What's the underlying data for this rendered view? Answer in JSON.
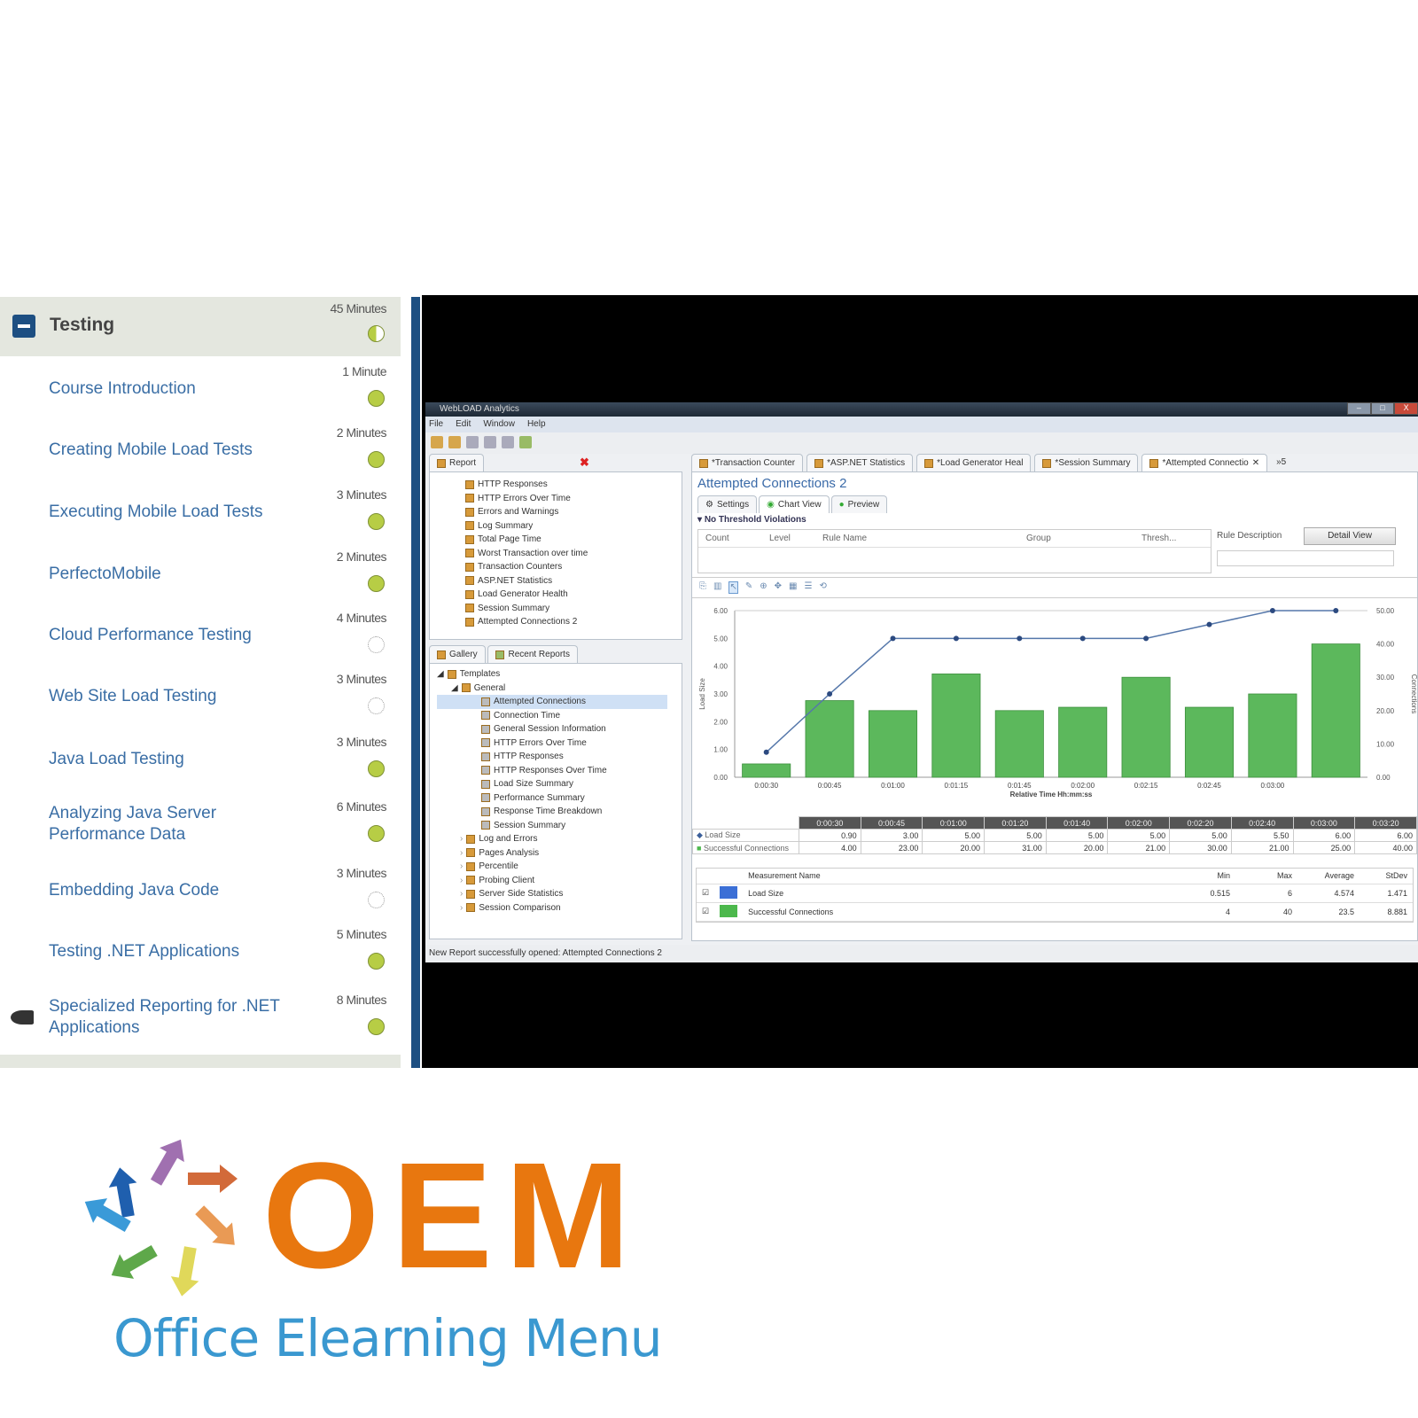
{
  "sidebar": {
    "section": {
      "title": "Testing",
      "duration": "45 Minutes",
      "status": "half"
    },
    "items": [
      {
        "title": "Course Introduction",
        "duration": "1 Minute",
        "status": "complete"
      },
      {
        "title": "Creating Mobile Load Tests",
        "duration": "2 Minutes",
        "status": "complete"
      },
      {
        "title": "Executing Mobile Load Tests",
        "duration": "3 Minutes",
        "status": "complete"
      },
      {
        "title": "PerfectoMobile",
        "duration": "2 Minutes",
        "status": "complete"
      },
      {
        "title": "Cloud Performance Testing",
        "duration": "4 Minutes",
        "status": "not-started"
      },
      {
        "title": "Web Site Load Testing",
        "duration": "3 Minutes",
        "status": "not-started"
      },
      {
        "title": "Java Load Testing",
        "duration": "3 Minutes",
        "status": "complete"
      },
      {
        "title": "Analyzing Java Server Performance Data",
        "duration": "6 Minutes",
        "status": "complete"
      },
      {
        "title": "Embedding Java Code",
        "duration": "3 Minutes",
        "status": "not-started"
      },
      {
        "title": "Testing .NET Applications",
        "duration": "5 Minutes",
        "status": "complete"
      },
      {
        "title": "Specialized Reporting for .NET Applications",
        "duration": "8 Minutes",
        "status": "complete",
        "current": true
      }
    ]
  },
  "app": {
    "title": "WebLOAD Analytics",
    "window_buttons": [
      "–",
      "□",
      "X"
    ],
    "menu": [
      "File",
      "Edit",
      "Window",
      "Help"
    ],
    "report_panel": {
      "tab": "Report",
      "items": [
        "HTTP Responses",
        "HTTP Errors Over Time",
        "Errors and Warnings",
        "Log Summary",
        "Total Page Time",
        "Worst Transaction over time",
        "Transaction Counters",
        "ASP.NET Statistics",
        "Load Generator Health",
        "Session Summary",
        "Attempted Connections 2"
      ]
    },
    "gallery_panel": {
      "tabs": [
        "Gallery",
        "Recent Reports"
      ],
      "root": "Templates",
      "group": "General",
      "templates": [
        "Attempted Connections",
        "Connection Time",
        "General Session Information",
        "HTTP Errors Over Time",
        "HTTP Responses",
        "HTTP Responses Over Time",
        "Load Size Summary",
        "Performance Summary",
        "Response Time Breakdown",
        "Session Summary"
      ],
      "selected": "Attempted Connections",
      "folders": [
        "Log and Errors",
        "Pages Analysis",
        "Percentile",
        "Probing Client",
        "Server Side Statistics",
        "Session Comparison"
      ]
    },
    "editor_tabs": [
      "*Transaction Counter",
      "*ASP.NET Statistics",
      "*Load Generator Heal",
      "*Session Summary",
      "*Attempted Connectio"
    ],
    "editor_tab_overflow": "»5",
    "report_title": "Attempted Connections 2",
    "view_tabs": [
      "Settings",
      "Chart View",
      "Preview"
    ],
    "threshold_label": "No Threshold Violations",
    "threshold_columns": [
      "Count",
      "Level",
      "Rule Name",
      "Group",
      "Thresh..."
    ],
    "rule_description_label": "Rule Description",
    "detail_view_button": "Detail View",
    "status": "New Report successfully opened: Attempted Connections 2",
    "data_table": {
      "headers": [
        "0:00:30",
        "0:00:45",
        "0:01:00",
        "0:01:20",
        "0:01:40",
        "0:02:00",
        "0:02:20",
        "0:02:40",
        "0:03:00",
        "0:03:20"
      ],
      "rows": [
        {
          "name": "Load Size",
          "values": [
            "0.90",
            "3.00",
            "5.00",
            "5.00",
            "5.00",
            "5.00",
            "5.00",
            "5.50",
            "6.00",
            "6.00"
          ]
        },
        {
          "name": "Successful Connections",
          "values": [
            "4.00",
            "23.00",
            "20.00",
            "31.00",
            "20.00",
            "21.00",
            "30.00",
            "21.00",
            "25.00",
            "40.00"
          ]
        }
      ]
    },
    "measurements": {
      "columns": [
        "Measurement Name",
        "Min",
        "Max",
        "Average",
        "StDev"
      ],
      "rows": [
        {
          "name": "Load Size",
          "color": "#3b6fd6",
          "min": "0.515",
          "max": "6",
          "avg": "4.574",
          "stdev": "1.471"
        },
        {
          "name": "Successful Connections",
          "color": "#4cb84c",
          "min": "4",
          "max": "40",
          "avg": "23.5",
          "stdev": "8.881"
        }
      ]
    }
  },
  "chart_data": {
    "type": "bar",
    "categories": [
      "0:00:30",
      "0:00:45",
      "0:01:00",
      "0:01:15",
      "0:01:45",
      "0:02:00",
      "0:02:15",
      "0:02:45",
      "0:03:00",
      ""
    ],
    "series": [
      {
        "name": "Successful Connections",
        "kind": "bar",
        "axis": "right",
        "color": "#5cb85c",
        "values": [
          4,
          23,
          20,
          31,
          20,
          21,
          30,
          21,
          25,
          40
        ]
      },
      {
        "name": "Load Size",
        "kind": "line",
        "axis": "left",
        "color": "#5577aa",
        "values": [
          0.9,
          3,
          5,
          5,
          5,
          5,
          5,
          5.5,
          6,
          6
        ]
      }
    ],
    "xlabel": "Relative Time Hh:mm:ss",
    "ylabel": "Load Size",
    "ylabel_right": "Connections",
    "ylim": [
      0,
      6
    ],
    "ylim_right": [
      0,
      50
    ],
    "yticks": [
      "0.00",
      "1.00",
      "2.00",
      "3.00",
      "4.00",
      "5.00",
      "6.00"
    ],
    "yticks_right": [
      "0.00",
      "10.00",
      "20.00",
      "30.00",
      "40.00",
      "50.00"
    ],
    "grid": false
  },
  "logo": {
    "letters": "OEM",
    "tagline": "Office Elearning Menu",
    "colors": {
      "orange": "#e8770f",
      "blue": "#3a98d0"
    }
  }
}
